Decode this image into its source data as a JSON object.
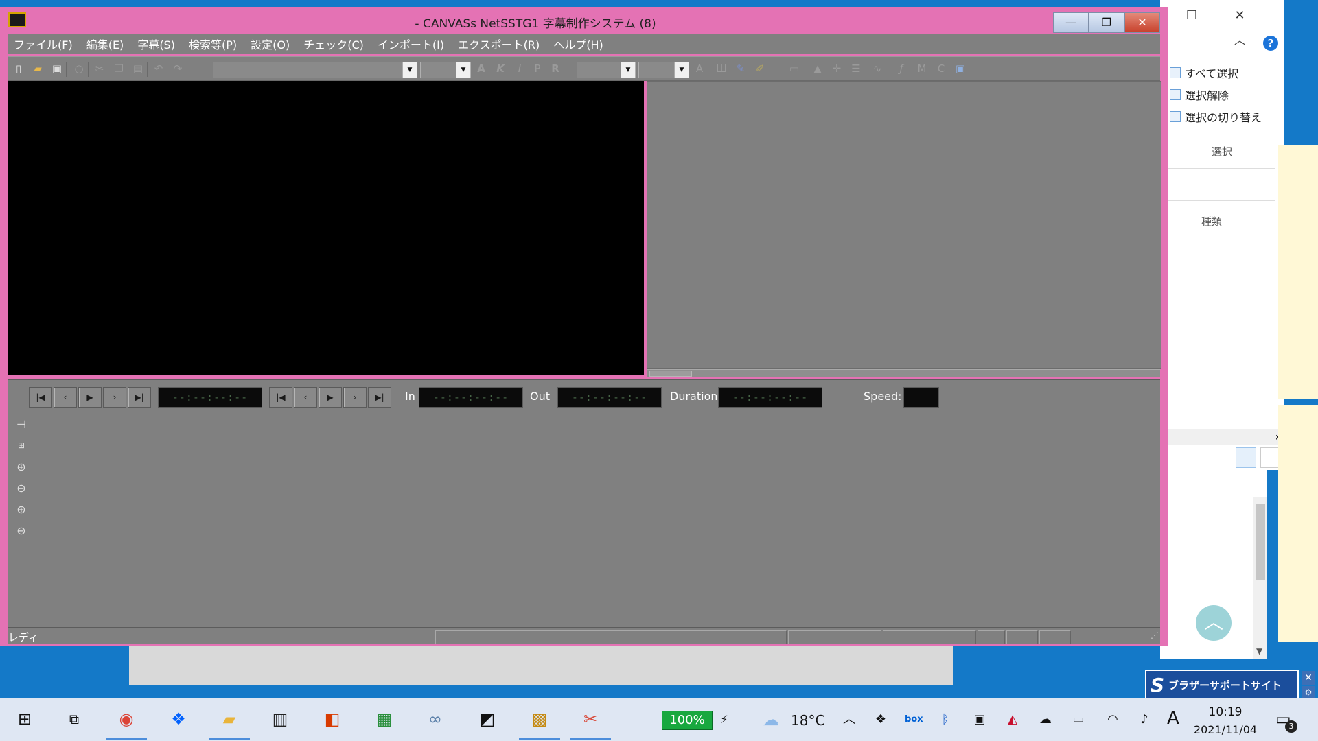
{
  "app": {
    "title": "- CANVASs NetSSTG1 字幕制作システム (8)",
    "menu": [
      "ファイル(F)",
      "編集(E)",
      "字幕(S)",
      "検索等(P)",
      "設定(O)",
      "チェック(C)",
      "インポート(I)",
      "エクスポート(R)",
      "ヘルプ(H)"
    ],
    "window_controls": {
      "minimize": "—",
      "maximize": "❐",
      "close": "✕"
    },
    "transport": {
      "in_label": "In",
      "out_label": "Out",
      "duration_label": "Duration",
      "speed_label": "Speed:",
      "timecode_blank": "--:--:--:--"
    },
    "status": "レディ"
  },
  "explorer": {
    "ribbon": [
      "すべて選択",
      "選択解除",
      "選択の切り替え"
    ],
    "group_label": "選択",
    "column_header": "種類",
    "help": "?"
  },
  "brother": {
    "label": "ブラザーサポートサイト",
    "logo": "S"
  },
  "taskbar": {
    "battery": "100%",
    "temperature": "18°C",
    "ime": "A",
    "time": "10:19",
    "date": "2021/11/04",
    "notifications": "3"
  },
  "colors": {
    "window_frame": "#e472b4",
    "panel_gray": "#808080",
    "video": "#000000",
    "desktop": "#1479c8",
    "battery": "#18a83f"
  }
}
